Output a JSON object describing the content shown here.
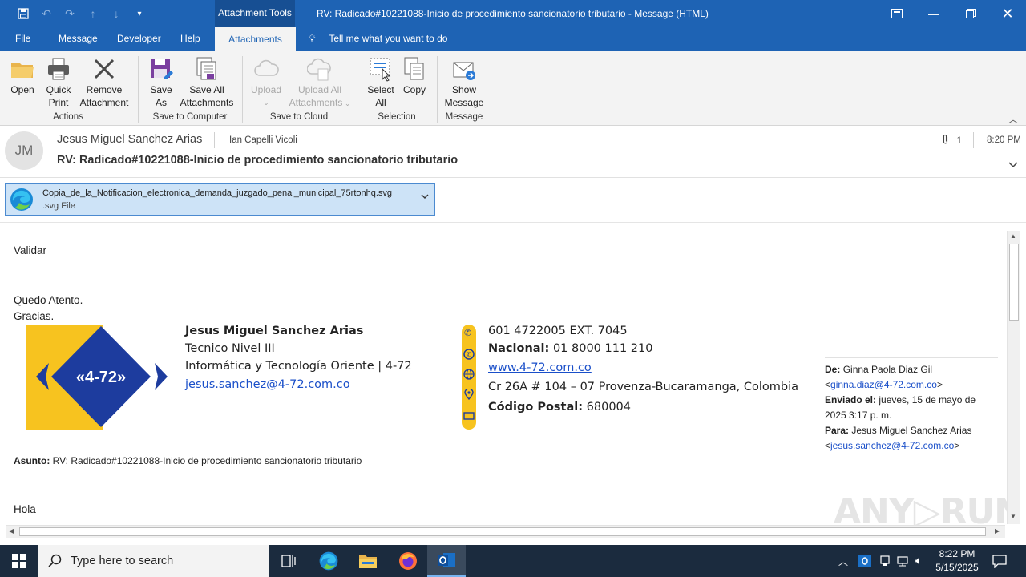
{
  "window": {
    "title": "RV: Radicado#10221088-Inicio de procedimiento sancionatorio tributario  -  Message (HTML)",
    "context_tab": "Attachment Tools"
  },
  "menu": {
    "tabs": [
      "File",
      "Message",
      "Developer",
      "Help"
    ],
    "active_tab": "Attachments",
    "tell_me": "Tell me what you want to do"
  },
  "ribbon": {
    "open": "Open",
    "quick_print_1": "Quick",
    "quick_print_2": "Print",
    "remove_1": "Remove",
    "remove_2": "Attachment",
    "group_actions": "Actions",
    "save_as_1": "Save",
    "save_as_2": "As",
    "save_all_1": "Save All",
    "save_all_2": "Attachments",
    "group_save_computer": "Save to Computer",
    "upload": "Upload",
    "upload_all_1": "Upload All",
    "upload_all_2": "Attachments",
    "group_save_cloud": "Save to Cloud",
    "select_all_1": "Select",
    "select_all_2": "All",
    "copy": "Copy",
    "group_selection": "Selection",
    "show_message_1": "Show",
    "show_message_2": "Message",
    "group_message": "Message"
  },
  "header": {
    "avatar_initials": "JM",
    "sender": "Jesus Miguel Sanchez Arias",
    "recipient": "Ian Capelli Vicoli",
    "subject": "RV: Radicado#10221088-Inicio de procedimiento sancionatorio tributario",
    "attachment_count": "1",
    "time": "8:20 PM"
  },
  "attachment": {
    "filename": "Copia_de_la_Notificacion_electronica_demanda_juzgado_penal_municipal_75rtonhq.svg",
    "filetype": ".svg File"
  },
  "body": {
    "line1": "Validar",
    "line2": "Quedo Atento.",
    "line3": "Gracias.",
    "signature": {
      "name": "Jesus Miguel Sanchez Arias",
      "role": "Tecnico Nivel III",
      "dept": "Informática y Tecnología Oriente | 4-72",
      "email": "jesus.sanchez@4-72.com.co",
      "phone": "601 4722005 EXT. 7045",
      "national_label": "Nacional:",
      "national": "01 8000 111 210",
      "web": "www.4-72.com.co",
      "address": "Cr 26A # 104 – 07 Provenza-Bucaramanga, Colombia",
      "postal_label": "Código Postal:",
      "postal": "680004",
      "logo_text": "«4-72»"
    },
    "forward": {
      "from_label": "De:",
      "from": "Ginna Paola Diaz Gil",
      "from_email": "ginna.diaz@4-72.com.co",
      "sent_label": "Enviado el:",
      "sent_1": "jueves, 15 de mayo de",
      "sent_2": "2025 3:17 p. m.",
      "to_label": "Para:",
      "to": "Jesus Miguel Sanchez Arias",
      "to_email": "jesus.sanchez@4-72.com.co",
      "subject_label": "Asunto:",
      "subject": "RV: Radicado#10221088-Inicio  de procedimiento sancionatorio tributario"
    },
    "greeting": "Hola"
  },
  "taskbar": {
    "search_placeholder": "Type here to search",
    "time": "8:22 PM",
    "date": "5/15/2025"
  },
  "colors": {
    "accent": "#1e63b4",
    "brand_yellow": "#f7c31f",
    "brand_blue": "#1d3c9e",
    "brand_red": "#e4322b"
  }
}
